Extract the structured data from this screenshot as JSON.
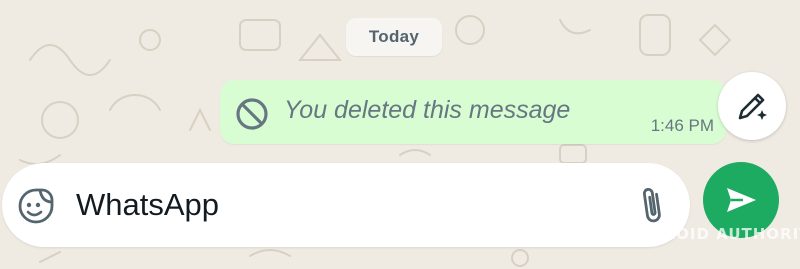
{
  "chat": {
    "date_chip": "Today",
    "message": {
      "text": "You deleted this message",
      "time": "1:46 PM",
      "icon": "ban-icon"
    }
  },
  "fab": {
    "icon": "edit-pencil-sparkle-icon"
  },
  "composer": {
    "value": "WhatsApp",
    "left_icon": "sticker-icon",
    "right_icon": "paperclip-icon",
    "send_icon": "send-icon"
  },
  "watermark": "ANDROID AUTHORITY",
  "colors": {
    "background": "#efeae2",
    "bubble": "#d9fdd3",
    "accent": "#1daa61",
    "muted_text": "#667781",
    "text": "#111b21"
  }
}
